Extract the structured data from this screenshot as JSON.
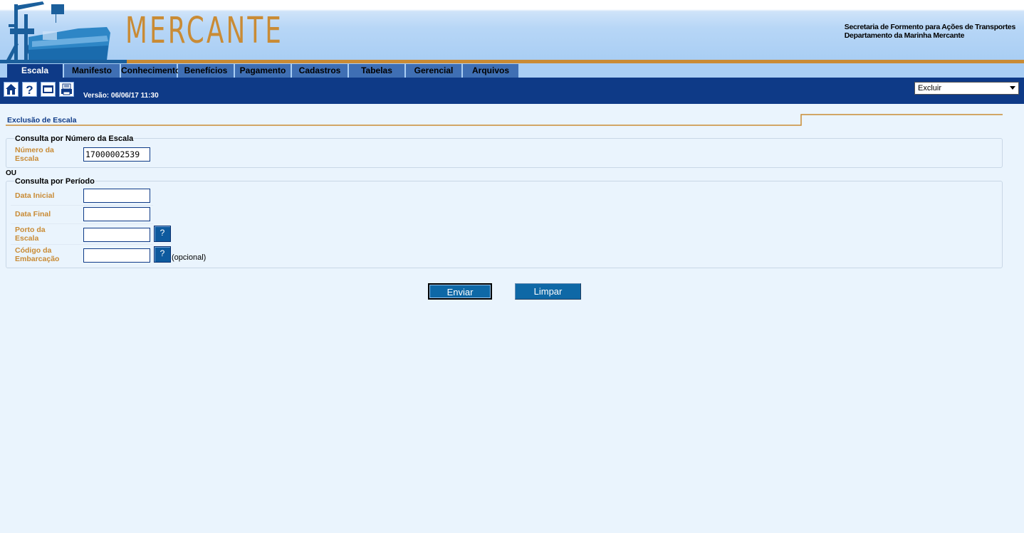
{
  "header": {
    "brand": "MERCANTE",
    "org_line1": "Secretaria de Formento para Ações de Transportes",
    "org_line2": "Departamento da Marinha Mercante"
  },
  "tabs": [
    {
      "label": "Escala",
      "active": true
    },
    {
      "label": "Manifesto",
      "active": false
    },
    {
      "label": "Conhecimento",
      "active": false
    },
    {
      "label": "Benefícios",
      "active": false
    },
    {
      "label": "Pagamento",
      "active": false
    },
    {
      "label": "Cadastros",
      "active": false
    },
    {
      "label": "Tabelas",
      "active": false
    },
    {
      "label": "Gerencial",
      "active": false
    },
    {
      "label": "Arquivos",
      "active": false
    }
  ],
  "toolbar": {
    "icons": [
      "home-icon",
      "help-icon",
      "window-icon",
      "print-icon"
    ],
    "version": "Versão: 06/06/17 11:30",
    "action_selected": "Excluir"
  },
  "page": {
    "title": "Exclusão de Escala",
    "section1": {
      "legend": "Consulta por Número da Escala",
      "numero_label_1": "Número da",
      "numero_label_2": "Escala",
      "numero_value": "17000002539"
    },
    "ou": "OU",
    "section2": {
      "legend": "Consulta por Período",
      "data_inicial": "Data Inicial",
      "data_final": "Data Final",
      "porto_1": "Porto da",
      "porto_2": "Escala",
      "codigo_1": "Código da",
      "codigo_2": "Embarcação",
      "help_label": "?",
      "optional": "(opcional)"
    },
    "buttons": {
      "enviar": "Enviar",
      "limpar": "Limpar"
    }
  },
  "colors": {
    "navy": "#0e3a87",
    "gold": "#c98b35",
    "tab_inactive": "#3f6fb4",
    "background": "#eaf4fd"
  }
}
